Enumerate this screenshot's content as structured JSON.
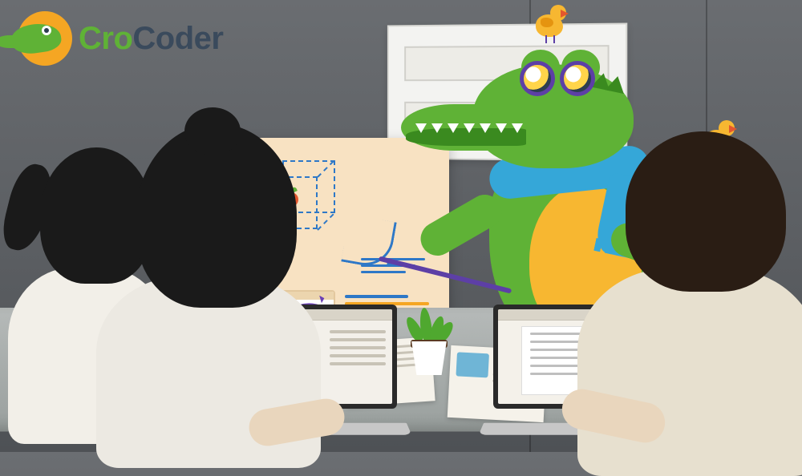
{
  "logo": {
    "text_part1": "Cro",
    "text_part2": "Coder"
  }
}
